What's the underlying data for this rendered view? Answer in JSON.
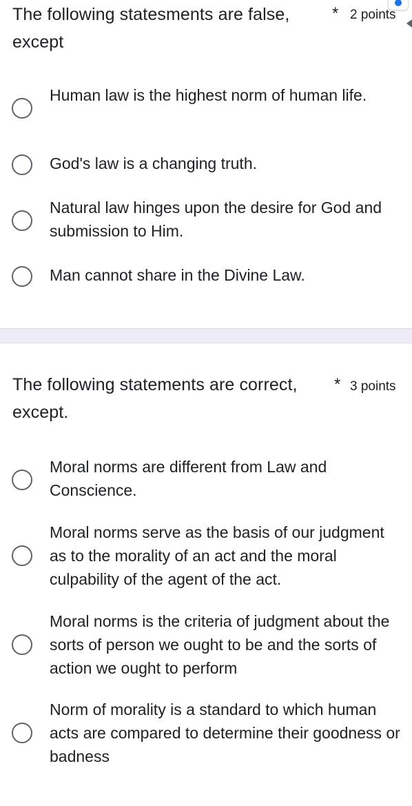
{
  "questions": [
    {
      "title": "The following statesments are false, except",
      "required_mark": "*",
      "points": "2 points",
      "options": [
        "Human law is the highest norm of human life.",
        "God's law is a changing truth.",
        "Natural law hinges upon the desire for God and submission to Him.",
        "Man cannot share in the Divine Law."
      ]
    },
    {
      "title": "The following statements are correct, except.",
      "required_mark": "*",
      "points": "3 points",
      "options": [
        "Moral norms are different from Law and Conscience.",
        "Moral norms serve as the basis of our judgment as to the morality of an act and the moral culpability of the agent of the act.",
        "Moral norms is the criteria of judgment about the sorts of person we ought to be and the sorts of action we ought to perform",
        "Norm of morality is a standard to which human acts are compared to determine their goodness or badness"
      ]
    }
  ],
  "colors": {
    "accent": "#1a73e8",
    "separator": "#f0ebf8",
    "text": "#202124",
    "radio_border": "#5f6368"
  }
}
